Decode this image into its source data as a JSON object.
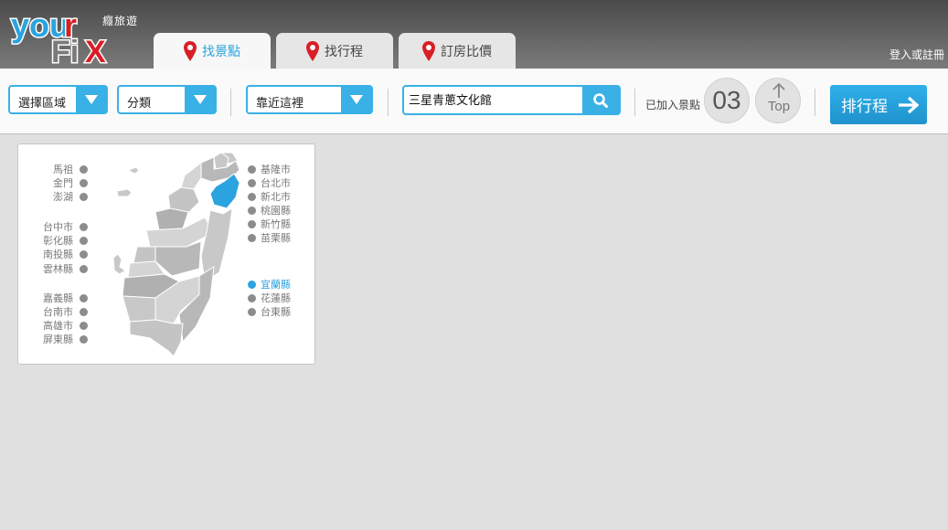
{
  "header": {
    "logo_text": "yourFiX",
    "logo_subtitle": "癮旅遊",
    "login_link": "登入或註冊",
    "tabs": [
      {
        "label": "找景點",
        "active": true
      },
      {
        "label": "找行程",
        "active": false
      },
      {
        "label": "訂房比價",
        "active": false
      }
    ]
  },
  "toolbar": {
    "area_select": "選擇區域",
    "category_select": "分類",
    "nearby_select": "靠近這裡",
    "search_value": "三星青蔥文化館",
    "added_label": "已加入景點",
    "added_count": "03",
    "top_label": "Top",
    "plan_button": "排行程"
  },
  "map": {
    "left_regions": [
      "馬祖",
      "金門",
      "澎湖",
      "台中市",
      "彰化縣",
      "南投縣",
      "雲林縣",
      "嘉義縣",
      "台南市",
      "高雄市",
      "屏東縣"
    ],
    "right_regions": [
      "基隆市",
      "台北市",
      "新北市",
      "桃園縣",
      "新竹縣",
      "苗栗縣",
      "宜蘭縣",
      "花蓮縣",
      "台東縣"
    ],
    "selected_region": "宜蘭縣"
  },
  "colors": {
    "accent": "#2aa3df",
    "header_dark": "#4a4a4a",
    "map_gray": "#c8c8c8",
    "map_selected": "#2aa3df"
  }
}
